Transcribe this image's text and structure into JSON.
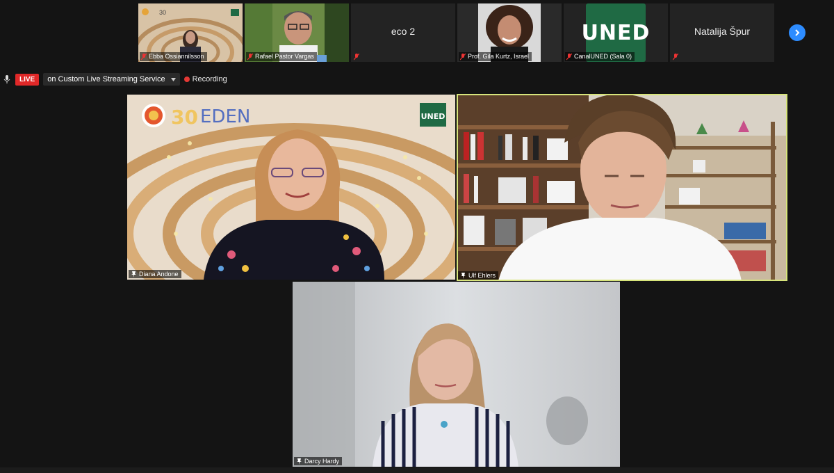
{
  "filmstrip": [
    {
      "name": "Ebba Ossiannilsson",
      "muted": true,
      "type": "video"
    },
    {
      "name": "Rafael Pastor Vargas",
      "muted": true,
      "type": "video"
    },
    {
      "name": "",
      "center_label": "eco 2",
      "muted": true,
      "type": "text"
    },
    {
      "name": "Prof. Gila Kurtz, Israel",
      "muted": true,
      "type": "video"
    },
    {
      "name": "CanalUNED (Sala 0)",
      "muted": true,
      "type": "logo",
      "logo_text": "UNED"
    },
    {
      "name": "",
      "center_label": "Natalija Špur",
      "muted": true,
      "type": "text"
    }
  ],
  "livebar": {
    "live_label": "LIVE",
    "stream_label": "on Custom Live Streaming Service",
    "recording_label": "Recording"
  },
  "main": {
    "tiles": [
      {
        "name": "Diana Andone",
        "logos": {
          "eden": "EDEN",
          "uned": "UNED",
          "num": "30"
        }
      },
      {
        "name": "Ulf Ehlers",
        "active_speaker": true
      },
      {
        "name": "Darcy Hardy"
      }
    ]
  },
  "colors": {
    "background": "#141414",
    "live": "#e02828",
    "active_border": "#d7e47b",
    "accent_blue": "#2d8cff",
    "uned_green": "#1f6a44"
  }
}
